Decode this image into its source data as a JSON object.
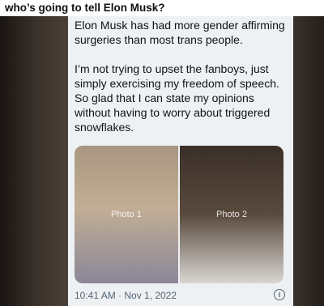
{
  "caption": "who’s going to tell Elon Musk?",
  "tweet": {
    "paragraphs": [
      "Elon Musk has had more gender affirming surgeries than most trans people.",
      "I’m not trying to upset the fanboys, just simply exercising my freedom of speech. So glad that I can state my opinions without having to worry about triggered snowflakes."
    ],
    "timestamp": "10:41 AM · Nov 1, 2022",
    "photos": [
      "Photo 1",
      "Photo 2"
    ]
  },
  "icons": {
    "info": "info-icon"
  }
}
